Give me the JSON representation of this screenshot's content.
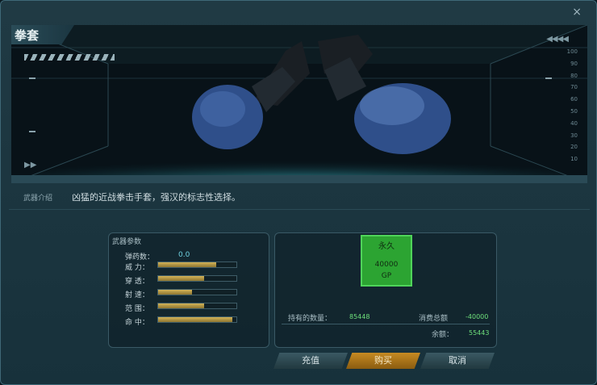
{
  "window": {
    "title": "拳套",
    "close_glyph": "×"
  },
  "preview": {
    "item_image": "boxing-gloves",
    "left_arrows": "▶▶",
    "right_arrows": "◀◀◀◀",
    "scale_marks": [
      "100",
      "90",
      "80",
      "70",
      "60",
      "50",
      "40",
      "30",
      "20",
      "10"
    ]
  },
  "description": {
    "label": "武器介绍",
    "text": "凶猛的近战拳击手套，强汉的标志性选择。"
  },
  "stats": {
    "title": "武器参数",
    "rows": [
      {
        "label": "弹药数：",
        "value": "0.0"
      },
      {
        "label": "威  力：",
        "level": 0.74
      },
      {
        "label": "穿  透：",
        "level": 0.59
      },
      {
        "label": "射  速：",
        "level": 0.43
      },
      {
        "label": "范  围：",
        "level": 0.59
      },
      {
        "label": "命  中：",
        "level": 0.95
      }
    ]
  },
  "purchase": {
    "option_name": "永久",
    "option_price": "40000",
    "option_currency": "GP",
    "owned_label": "持有的数量：",
    "owned_value": "85448",
    "cost_label": "消费总额",
    "cost_value": "-40000",
    "balance_label": "余额：",
    "balance_value": "55443"
  },
  "buttons": {
    "recharge": "充值",
    "buy": "购买",
    "cancel": "取消"
  },
  "colors": {
    "accent": "#2ca432",
    "buy_button": "#c68a22",
    "value_text": "#6ee07b"
  }
}
